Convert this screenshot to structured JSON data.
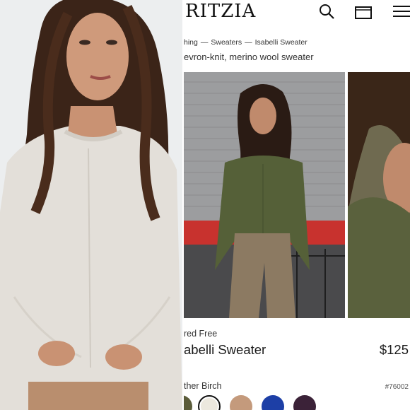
{
  "header": {
    "logo": "RITZIA",
    "icons": [
      "search-icon",
      "bag-icon",
      "menu-icon"
    ]
  },
  "breadcrumb": {
    "items": [
      "hing",
      "Sweaters",
      "Isabelli Sweater"
    ],
    "separator": "—"
  },
  "subtitle": "evron-knit, merino wool sweater",
  "product": {
    "promo": "red Free",
    "name": "abelli Sweater",
    "price": "$125",
    "color_label": "ther Birch",
    "style_number": "#76002"
  },
  "swatches": [
    {
      "name": "olive",
      "color": "#5b5c3a",
      "selected": false
    },
    {
      "name": "birch",
      "color": "#ece8de",
      "selected": true
    },
    {
      "name": "camel",
      "color": "#c49a7c",
      "selected": false
    },
    {
      "name": "cobalt",
      "color": "#1d3fa6",
      "selected": false
    },
    {
      "name": "plum",
      "color": "#3b2238",
      "selected": false
    }
  ],
  "colors": {
    "accent": "#111111",
    "sweater_olive": "#556038",
    "sweater_birch": "#e4e0da",
    "brick_red": "#c8322e"
  }
}
